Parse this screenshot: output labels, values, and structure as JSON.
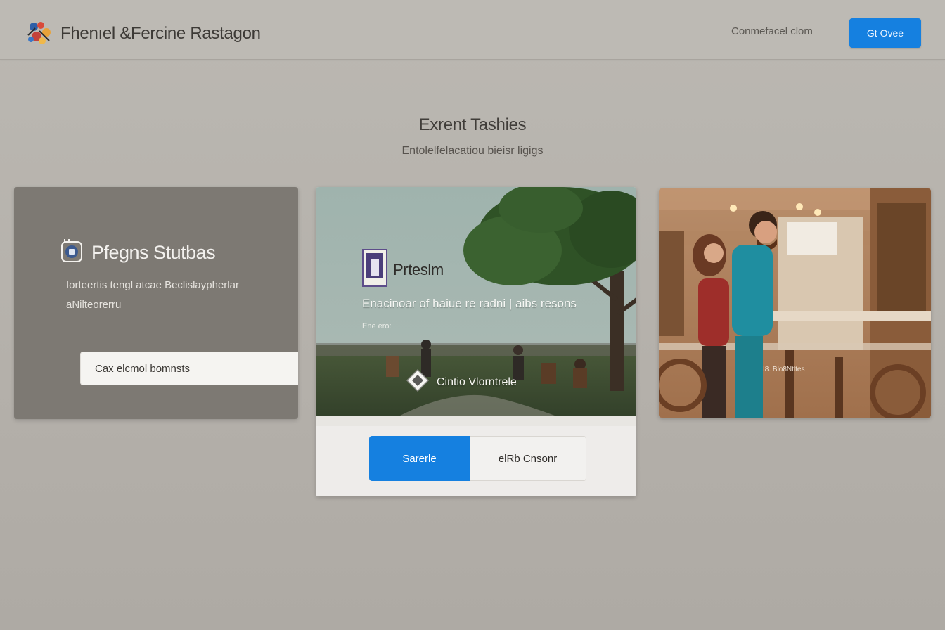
{
  "header": {
    "title": "Fhenıel &Fercine Rastagon",
    "nav_link": "Conmefacel clom",
    "cta_label": "Gt Ovee"
  },
  "hero": {
    "title": "Exrent Tashies",
    "subtitle": "Entolelfelacatiou bieisr ligigs"
  },
  "card1": {
    "title": "Pfegns Stutbas",
    "description": "Iorteertis tengl atcae Beclislaypherlar aNilteorerru",
    "input_value": "Cax elcmol bomnsts"
  },
  "card2": {
    "overlay_title": "Prteslm",
    "overlay_text": "Enacinoar of haiue re radni | aibs resons",
    "small_text": "Ene ero:",
    "brand_text": "Cintio Vlorntrele",
    "primary_button": "Sarerle",
    "secondary_button": "elRb Cnsonr"
  },
  "card3": {
    "caption": "I8. Blo8Ntltes"
  },
  "colors": {
    "accent": "#1580e0",
    "background": "#b7b3ad",
    "card_dark": "#7d7973"
  },
  "icons": {
    "brand_logo": "colorful-cluster-icon",
    "card1_icon": "badge-icon",
    "card2_logo": "book-logo-icon",
    "card2_brand_mark": "diamond-icon"
  }
}
